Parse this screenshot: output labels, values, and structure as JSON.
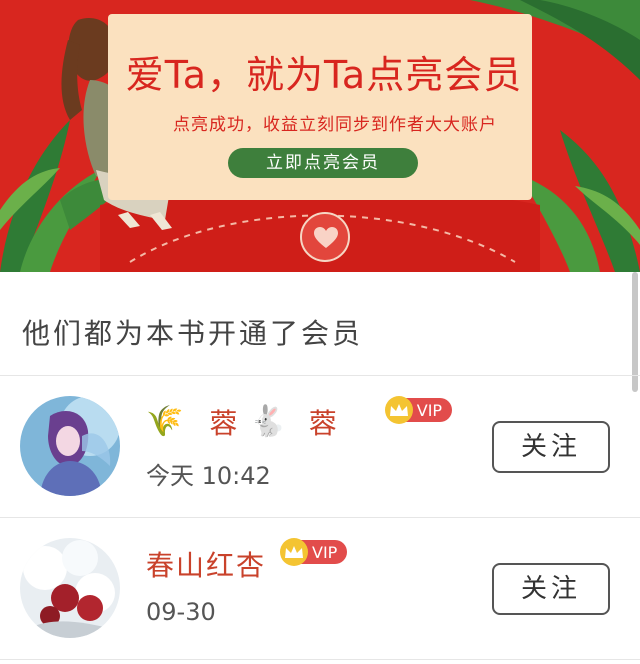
{
  "banner": {
    "title": "爱Ta，就为Ta点亮会员",
    "subtitle": "点亮成功，收益立刻同步到作者大大账户",
    "cta_label": "立即点亮会员"
  },
  "section": {
    "title": "他们都为本书开通了会员"
  },
  "members": [
    {
      "name_part1": "蓉",
      "name_part2": "蓉",
      "prefix_icon": "🌾",
      "middle_icon": "🐇",
      "vip_label": "VIP",
      "time": "今天 10:42",
      "follow_label": "关注"
    },
    {
      "name": "春山红杏",
      "vip_label": "VIP",
      "time": "09-30",
      "follow_label": "关注"
    }
  ],
  "colors": {
    "banner_red": "#d8261f",
    "card_cream": "#fbe1bf",
    "cta_green": "#3e7f3c",
    "name_red": "#c9422b",
    "vip_red": "#e24c4b",
    "crown_gold": "#f4c432"
  }
}
